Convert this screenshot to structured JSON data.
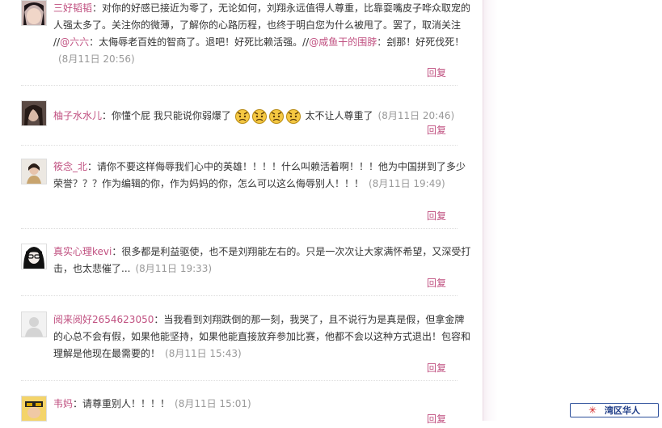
{
  "comments": [
    {
      "user": "三好韬韬",
      "text_parts": [
        "：对你的好感已接近为零了，无论如何，刘翔永远值得人尊重，比靠耍嘴皮子哗众取宠的人强太多了。关注你的微薄，了解你的心路历程，也终于明白您为什么被甩了。罢了，取消关注 //",
        "：太侮辱老百姓的智商了。退吧！好死比赖活强。//",
        "：刽那！好死伐死！"
      ],
      "mentions": [
        "@六六",
        "@咸鱼干的围脖"
      ],
      "time": "(8月11日 20:56)",
      "reply": "回复"
    },
    {
      "user": "柚子水水儿",
      "text_before": "：你懂个屁 我只能说你弱爆了",
      "text_after": "太不让人尊重了",
      "time": "(8月11日 20:46)",
      "reply": "回复",
      "emoticon_count": 4
    },
    {
      "user": "筱念_北",
      "text": "：请你不要这样侮辱我们心中的英雄！！！！什么叫赖活着啊！！！他为中国拼到了多少荣誉？？？作为编辑的你，作为妈妈的你，怎么可以这么侮辱别人！！！",
      "time": "(8月11日 19:49)",
      "reply": "回复"
    },
    {
      "user": "真实心理kevi",
      "text": "：很多都是利益驱使，也不是刘翔能左右的。只是一次次让大家满怀希望，又深受打击，也太悲催了...",
      "time": "(8月11日 19:33)",
      "reply": "回复"
    },
    {
      "user": "阅来阅好2654623050",
      "text": "：当我看到刘翔跌倒的那一刻，我哭了，且不说行为是真是假，但拿金牌的心总不会有假，如果他能坚持，如果他能直接放弃参加比赛，他都不会以这种方式退出！包容和理解是他现在最需要的！",
      "time": "(8月11日 15:43)",
      "reply": "回复"
    },
    {
      "user": "韦妈",
      "text": "：请尊重别人！！！！",
      "time": "(8月11日 15:01)",
      "reply": "回复"
    }
  ],
  "watermark": {
    "star": "✳",
    "text": "湾区华人"
  },
  "colors": {
    "username": "#c05080",
    "time": "#999999",
    "badge": "#1d3b86"
  }
}
